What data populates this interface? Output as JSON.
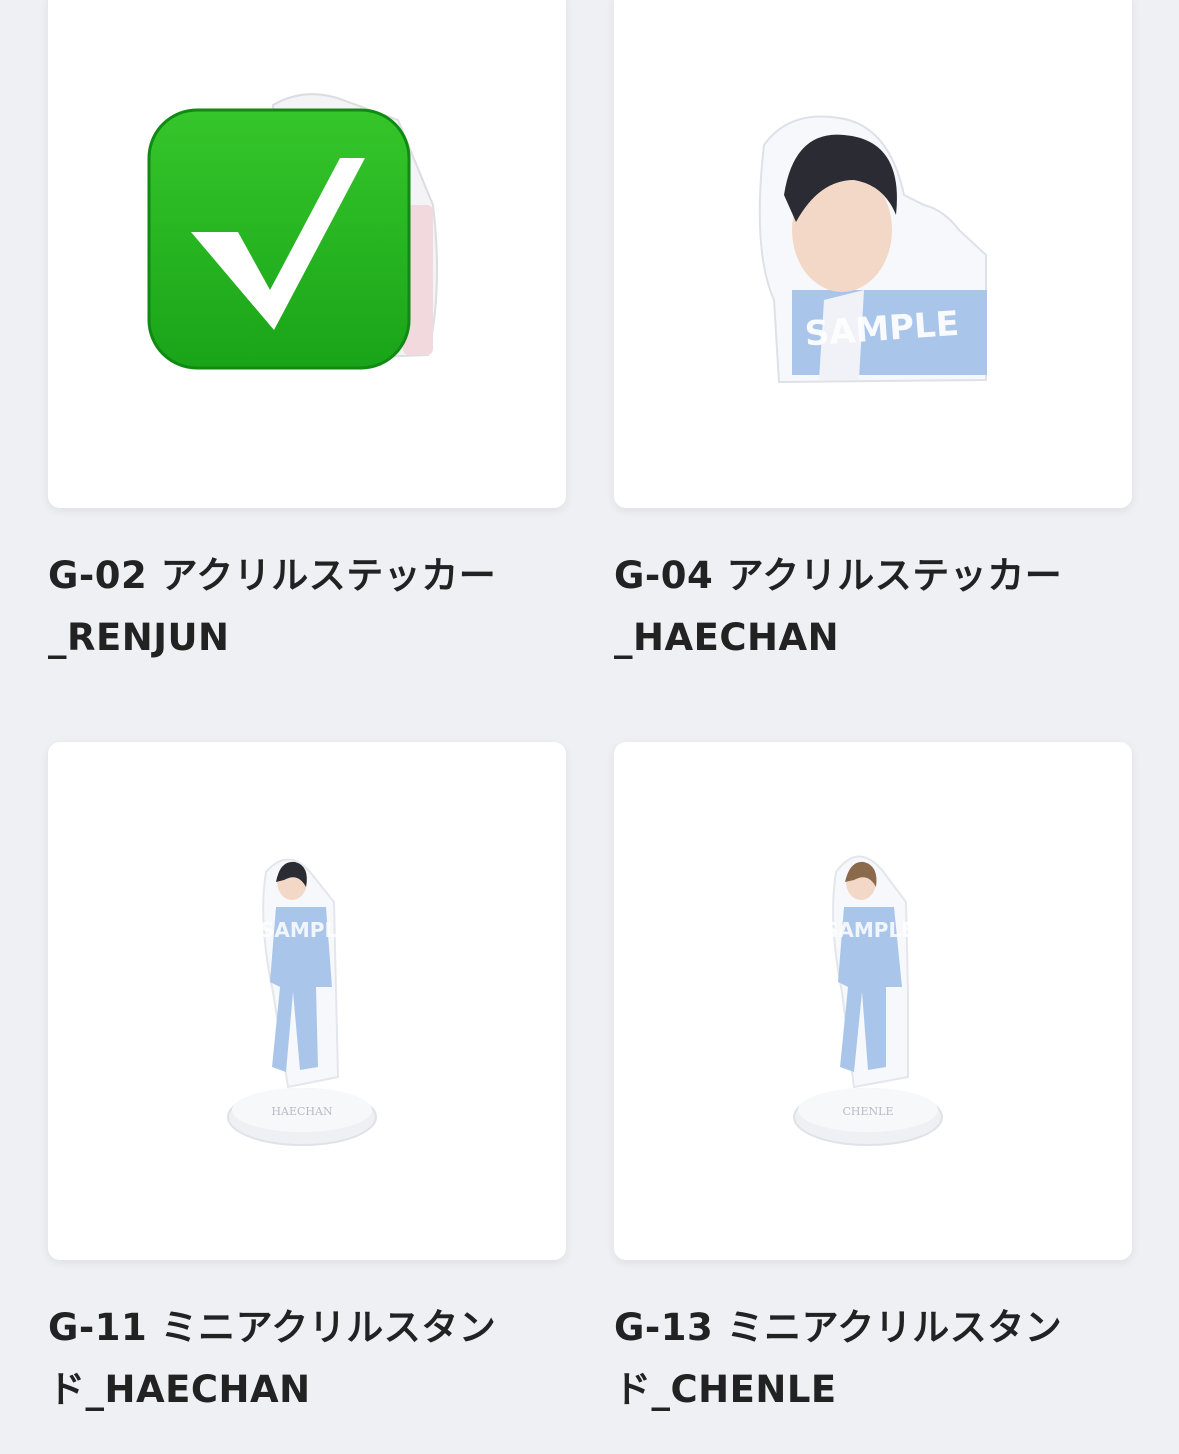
{
  "products": [
    {
      "code": "G-02",
      "title_line1": "G-02 アクリルステッカー",
      "title_line2": "_RENJUN",
      "checked": true,
      "overlay_icon": "check-mark-button-icon",
      "watermark": ""
    },
    {
      "code": "G-04",
      "title_line1": "G-04 アクリルステッカー",
      "title_line2": "_HAECHAN",
      "checked": false,
      "watermark": "SAMPLE"
    },
    {
      "code": "G-11",
      "title_line1": "G-11 ミニアクリルスタン",
      "title_line2": "ド_HAECHAN",
      "checked": false,
      "watermark": "SAMPLE",
      "base_text": "HAECHAN"
    },
    {
      "code": "G-13",
      "title_line1": "G-13 ミニアクリルスタン",
      "title_line2": "ド_CHENLE",
      "checked": false,
      "watermark": "SAMPLE",
      "base_text": "CHENLE"
    }
  ],
  "colors": {
    "background": "#eef0f4",
    "card": "#ffffff",
    "check_green": "#22b61e",
    "suit_blue": "#a9c6ea"
  }
}
